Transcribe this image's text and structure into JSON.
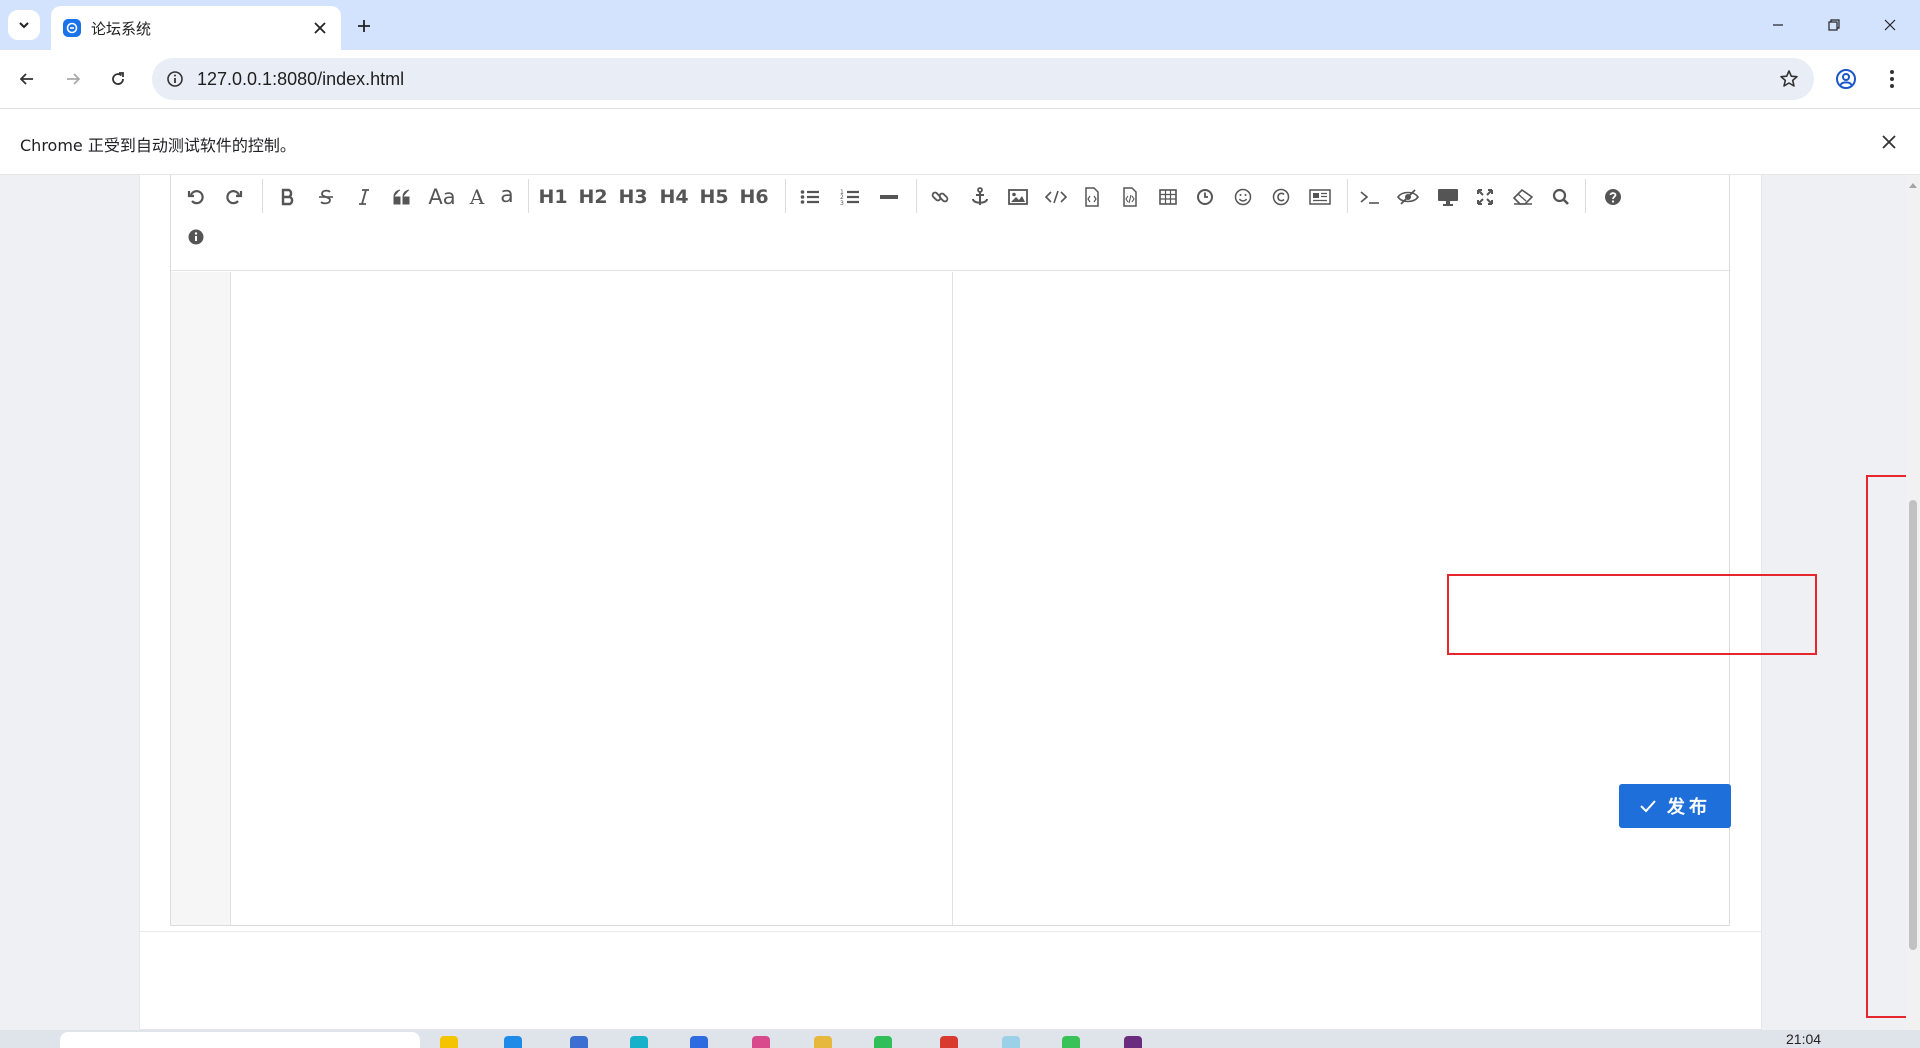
{
  "browser": {
    "tab_title": "论坛系统",
    "url": "127.0.0.1:8080/index.html",
    "infobar_text": "Chrome 正受到自动测试软件的控制。"
  },
  "editor": {
    "toolbar_row1": [
      {
        "name": "undo-icon",
        "kind": "icon"
      },
      {
        "name": "redo-icon",
        "kind": "icon"
      },
      {
        "name": "bold-icon",
        "kind": "icon"
      },
      {
        "name": "strikethrough-icon",
        "kind": "icon"
      },
      {
        "name": "italic-icon",
        "kind": "icon"
      },
      {
        "name": "quote-icon",
        "kind": "icon"
      },
      {
        "name": "uppercase-icon",
        "kind": "text",
        "label": "Aa"
      },
      {
        "name": "uppercase-a-icon",
        "kind": "text",
        "label": "A"
      },
      {
        "name": "lowercase-a-icon",
        "kind": "text",
        "label": "a"
      },
      {
        "name": "h1-button",
        "kind": "text",
        "label": "H1"
      },
      {
        "name": "h2-button",
        "kind": "text",
        "label": "H2"
      },
      {
        "name": "h3-button",
        "kind": "text",
        "label": "H3"
      },
      {
        "name": "h4-button",
        "kind": "text",
        "label": "H4"
      },
      {
        "name": "h5-button",
        "kind": "text",
        "label": "H5"
      },
      {
        "name": "h6-button",
        "kind": "text",
        "label": "H6"
      }
    ],
    "toolbar_icons": [
      "list-ul-icon",
      "list-ol-icon",
      "hr-icon",
      "link-icon",
      "anchor-icon",
      "image-icon",
      "code-icon",
      "code-block-icon",
      "file-code-icon",
      "table-icon",
      "clock-icon",
      "smiley-icon",
      "copyright-icon",
      "newspaper-icon",
      "terminal-icon",
      "eye-slash-icon",
      "desktop-icon",
      "fullscreen-icon",
      "eraser-icon",
      "search-icon",
      "help-icon",
      "info-icon"
    ]
  },
  "actions": {
    "publish_label": "发布"
  },
  "taskbar": {
    "time": "21:04"
  },
  "colors": {
    "accent": "#1e6fd9",
    "highlight": "#e5262c",
    "tabbar": "#d3e3fd"
  }
}
